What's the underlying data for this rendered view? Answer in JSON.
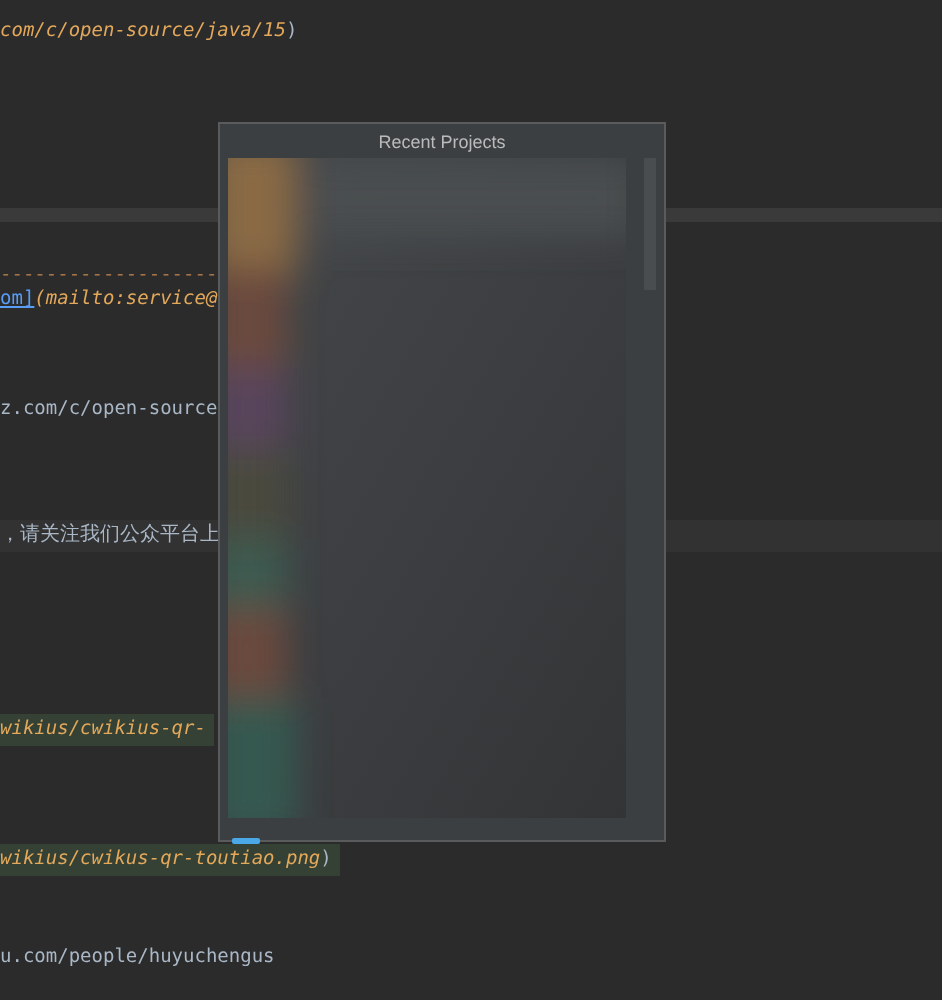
{
  "editor": {
    "lines": [
      {
        "current": false,
        "highlighted": false,
        "segments": [
          {
            "kind": "link",
            "text": "com/c/open-source/java/15"
          },
          {
            "kind": "plain",
            "text": ")"
          }
        ]
      },
      {
        "current": false,
        "highlighted": false,
        "segments": [
          {
            "kind": "rule",
            "text": "-------------------"
          }
        ]
      },
      {
        "current": false,
        "highlighted": false,
        "segments": [
          {
            "kind": "anchor",
            "text": "om]"
          },
          {
            "kind": "link",
            "text": "(mailto:service@"
          }
        ]
      },
      {
        "current": false,
        "highlighted": false,
        "segments": [
          {
            "kind": "plain",
            "text": "z.com/c/open-source"
          }
        ]
      },
      {
        "current": true,
        "highlighted": false,
        "segments": [
          {
            "kind": "plain",
            "text": "，请关注我们公众平台上"
          }
        ]
      },
      {
        "current": false,
        "highlighted": true,
        "segments": [
          {
            "kind": "link",
            "text": "wikius/cwikius-qr-"
          }
        ]
      },
      {
        "current": false,
        "highlighted": true,
        "segments": [
          {
            "kind": "link",
            "text": "wikius/cwikus-qr-toutiao.png"
          },
          {
            "kind": "plain",
            "text": ")"
          }
        ]
      },
      {
        "current": false,
        "highlighted": false,
        "segments": [
          {
            "kind": "plain",
            "text": "u.com/people/huyuchengus"
          }
        ]
      }
    ]
  },
  "popup": {
    "title": "Recent Projects"
  }
}
